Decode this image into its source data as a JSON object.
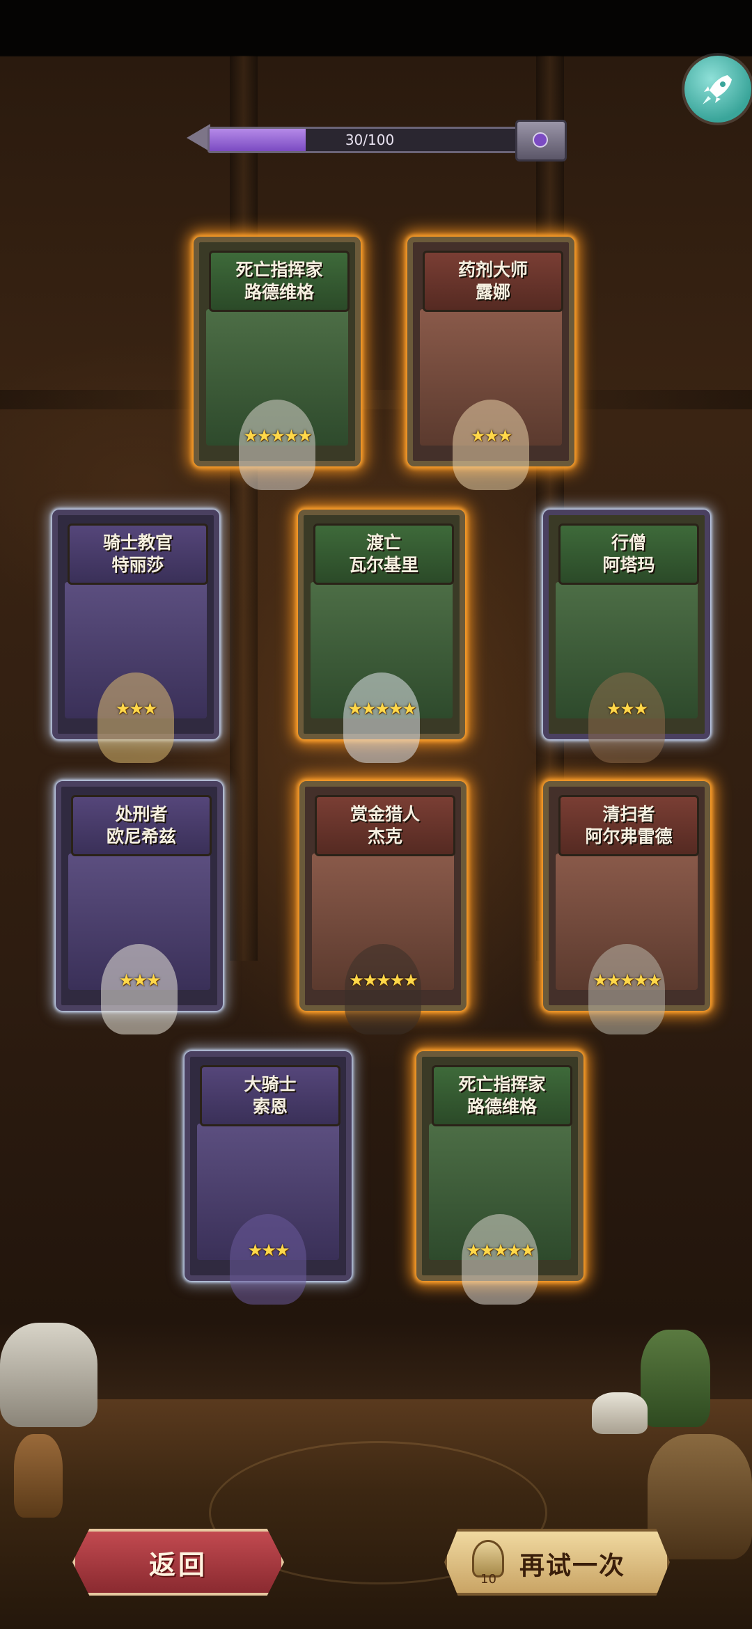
{
  "progress": {
    "current_label": "30/100",
    "fraction": 0.3
  },
  "cards": [
    {
      "title_line1": "死亡指挥家",
      "title_line2": "路德维格",
      "stars": "★★★★★",
      "theme": "green",
      "glow": "gold"
    },
    {
      "title_line1": "药剂大师",
      "title_line2": "露娜",
      "stars": "★★★",
      "theme": "red",
      "glow": "gold"
    },
    {
      "title_line1": "骑士教官",
      "title_line2": "特丽莎",
      "stars": "★★★",
      "theme": "purple",
      "glow": "blue"
    },
    {
      "title_line1": "渡亡",
      "title_line2": "瓦尔基里",
      "stars": "★★★★★",
      "theme": "green",
      "glow": "gold"
    },
    {
      "title_line1": "行僧",
      "title_line2": "阿塔玛",
      "stars": "★★★",
      "theme": "green",
      "glow": "blue"
    },
    {
      "title_line1": "处刑者",
      "title_line2": "欧尼希兹",
      "stars": "★★★",
      "theme": "purple",
      "glow": "blue"
    },
    {
      "title_line1": "赏金猎人",
      "title_line2": "杰克",
      "stars": "★★★★★",
      "theme": "red",
      "glow": "gold"
    },
    {
      "title_line1": "清扫者",
      "title_line2": "阿尔弗雷德",
      "stars": "★★★★★",
      "theme": "red",
      "glow": "gold"
    },
    {
      "title_line1": "大骑士",
      "title_line2": "索恩",
      "stars": "★★★",
      "theme": "purple",
      "glow": "blue"
    },
    {
      "title_line1": "死亡指挥家",
      "title_line2": "路德维格",
      "stars": "★★★★★",
      "theme": "green",
      "glow": "gold"
    }
  ],
  "buttons": {
    "back_label": "返回",
    "retry_label": "再试一次",
    "retry_cost": "10"
  },
  "icons": {
    "top_right": "rocket-icon",
    "progress_reward": "chest-icon",
    "retry_cost": "key-icon"
  },
  "colors": {
    "gold_glow": "#ffa020",
    "blue_glow": "#cfe0ff",
    "back_button": "#b0383e",
    "retry_button": "#e6c98c",
    "rocket_button": "#4fbfb2"
  }
}
